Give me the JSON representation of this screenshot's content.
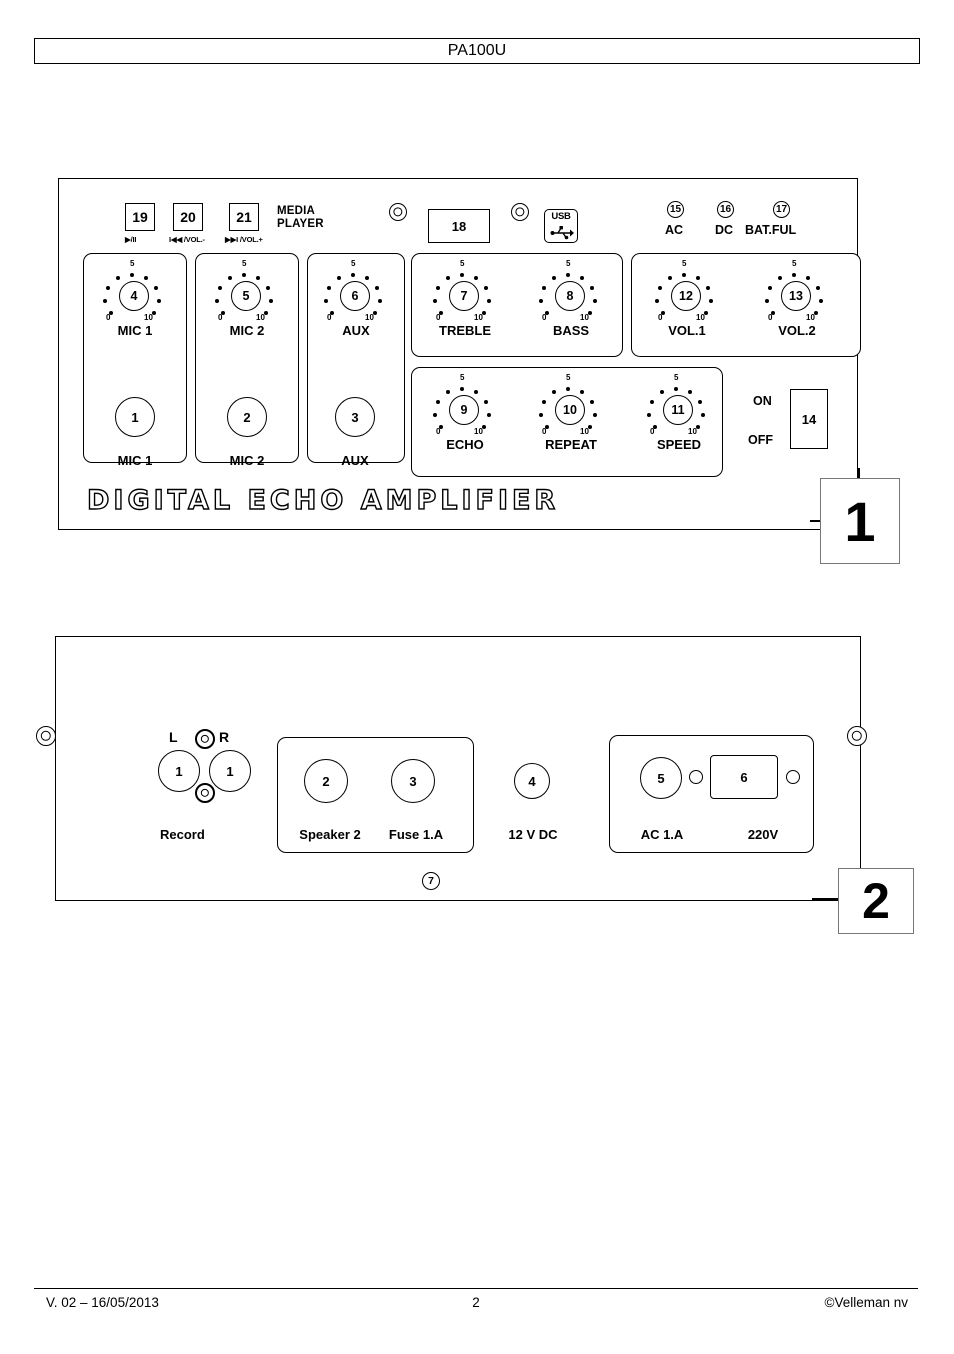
{
  "document": {
    "header_title": "PA100U",
    "footer": {
      "version": "V. 02 – 16/05/2013",
      "page_number": "2",
      "copyright": "©Velleman nv"
    }
  },
  "figures": {
    "front_panel_label": "1",
    "rear_panel_label": "2"
  },
  "front_panel": {
    "brand_text": "DIGITAL ECHO AMPLIFIER",
    "media_player": {
      "title_line1": "MEDIA",
      "title_line2": "PLAYER",
      "buttons": [
        {
          "number": "19",
          "sublabel": "▶/II"
        },
        {
          "number": "20",
          "sublabel": "I◀◀ /VOL.-"
        },
        {
          "number": "21",
          "sublabel": "▶▶I /VOL.+"
        }
      ]
    },
    "display": {
      "number": "18"
    },
    "usb": {
      "word": "USB",
      "icon": "usb-icon"
    },
    "indicators": [
      {
        "number": "15",
        "label": "AC"
      },
      {
        "number": "16",
        "label": "DC"
      },
      {
        "number": "17",
        "label": "BAT.FUL"
      }
    ],
    "knob_scale": {
      "min": "0",
      "mid": "5",
      "max": "10"
    },
    "knobs": [
      {
        "number": "4",
        "label": "MIC 1"
      },
      {
        "number": "5",
        "label": "MIC 2"
      },
      {
        "number": "6",
        "label": "AUX"
      },
      {
        "number": "7",
        "label": "TREBLE"
      },
      {
        "number": "8",
        "label": "BASS"
      },
      {
        "number": "12",
        "label": "VOL.1"
      },
      {
        "number": "13",
        "label": "VOL.2"
      },
      {
        "number": "9",
        "label": "ECHO"
      },
      {
        "number": "10",
        "label": "REPEAT"
      },
      {
        "number": "11",
        "label": "SPEED"
      }
    ],
    "jacks": [
      {
        "number": "1",
        "label": "MIC 1"
      },
      {
        "number": "2",
        "label": "MIC 2"
      },
      {
        "number": "3",
        "label": "AUX"
      }
    ],
    "power_switch": {
      "number": "14",
      "on_label": "ON",
      "off_label": "OFF"
    }
  },
  "rear_panel": {
    "record": {
      "group_label": "Record",
      "left_label": "L",
      "right_label": "R",
      "left_jack_number": "1",
      "right_jack_number": "1"
    },
    "speaker": {
      "label": "Speaker 2",
      "jack_number": "2"
    },
    "fuse": {
      "label": "Fuse 1.A",
      "jack_number": "3"
    },
    "dc_input": {
      "label": "12 V DC",
      "jack_number": "4"
    },
    "ac_input": {
      "label": "AC 1.A",
      "jack_number": "5"
    },
    "mains": {
      "label": "220V",
      "connector_number": "6"
    },
    "bottom_marker": "7"
  }
}
